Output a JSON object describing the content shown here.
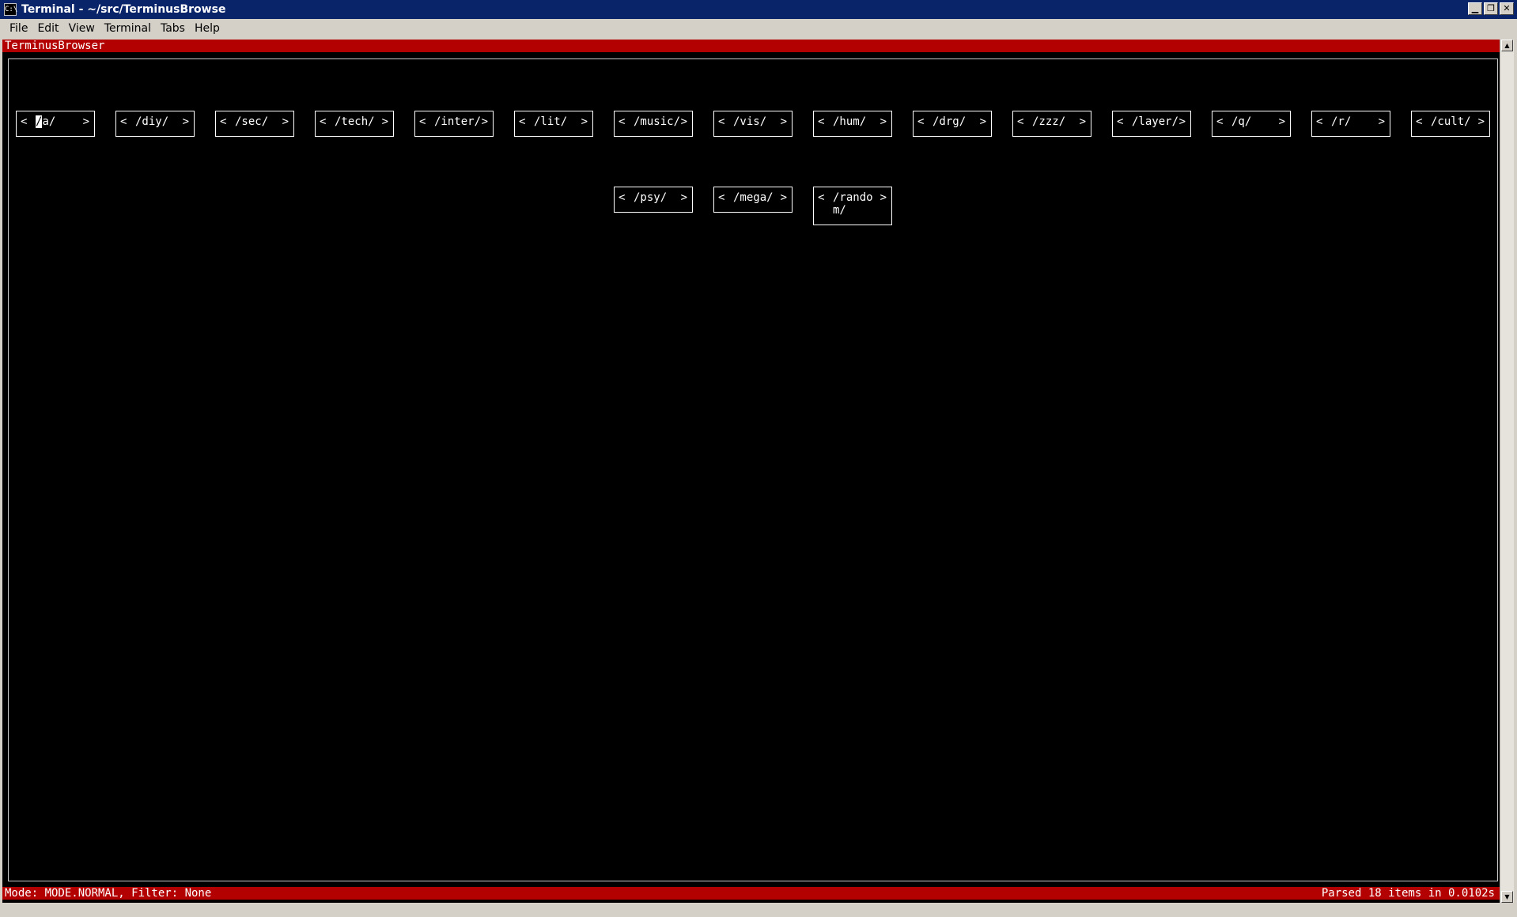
{
  "window": {
    "title": "Terminal - ~/src/TerminusBrowse",
    "icon_label": "C:\\",
    "controls": {
      "minimize": "▁",
      "maximize": "❐",
      "close": "✕"
    }
  },
  "menu": [
    "File",
    "Edit",
    "View",
    "Terminal",
    "Tabs",
    "Help"
  ],
  "app": {
    "header": "TerminusBrowser",
    "boards": [
      {
        "label": "/a/"
      },
      {
        "label": "/diy/"
      },
      {
        "label": "/sec/"
      },
      {
        "label": "/tech/"
      },
      {
        "label": "/inter/"
      },
      {
        "label": "/lit/"
      },
      {
        "label": "/music/"
      },
      {
        "label": "/vis/"
      },
      {
        "label": "/hum/"
      },
      {
        "label": "/drg/"
      },
      {
        "label": "/zzz/"
      },
      {
        "label": "/layer/"
      },
      {
        "label": "/q/"
      },
      {
        "label": "/r/"
      },
      {
        "label": "/cult/"
      },
      {
        "label": "/psy/"
      },
      {
        "label": "/mega/"
      },
      {
        "label": "/random/"
      }
    ],
    "arrow_left": "<",
    "arrow_right": ">",
    "status_left": "Mode: MODE.NORMAL, Filter: None",
    "status_right": "Parsed 18 items in 0.0102s"
  },
  "scrollbar": {
    "up": "▲",
    "down": "▼"
  }
}
